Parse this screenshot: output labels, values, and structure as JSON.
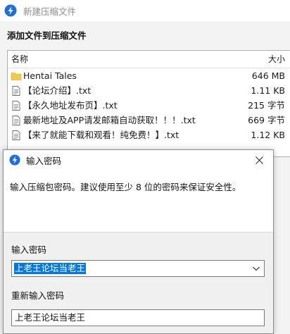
{
  "window": {
    "title": "新建压缩文件",
    "section_heading": "添加文件到压缩文件"
  },
  "file_list": {
    "columns": {
      "name": "名称",
      "size": "大小"
    },
    "rows": [
      {
        "name": "Hentai Tales",
        "size": "646 MB",
        "icon": "folder-icon"
      },
      {
        "name": "【论坛介绍】.txt",
        "size": "1.11 KB",
        "icon": "text-file-icon"
      },
      {
        "name": "【永久地址发布页】.txt",
        "size": "215 字节",
        "icon": "text-file-icon"
      },
      {
        "name": "最新地址及APP请发邮箱自动获取！！！.txt",
        "size": "669 字节",
        "icon": "text-file-icon"
      },
      {
        "name": "【来了就能下载和观看！纯免费！】.txt",
        "size": "1.12 KB",
        "icon": "text-file-icon"
      }
    ]
  },
  "dialog": {
    "title": "输入密码",
    "info": "输入压缩包密码。建议使用至少 8 位的密码来保证安全性。",
    "password_label": "输入密码",
    "password_value": "上老王论坛当老王",
    "confirm_label": "重新输入密码",
    "confirm_value": "上老王论坛当老王"
  },
  "colors": {
    "accent": "#0078d7",
    "folder": "#f4c84e",
    "app_icon": "#1e6fd9"
  }
}
